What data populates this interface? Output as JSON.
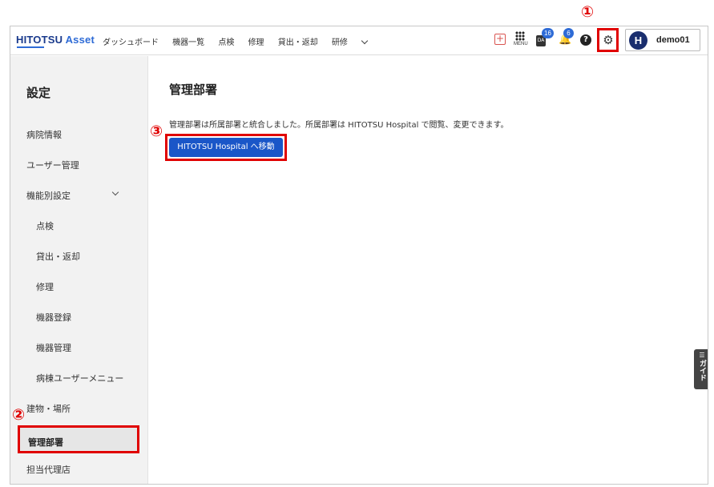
{
  "header": {
    "logo_main": "HITOTSU ",
    "logo_accent": "Asset",
    "nav": [
      "ダッシュボード",
      "機器一覧",
      "点検",
      "修理",
      "貸出・返却",
      "研修"
    ],
    "menu_label": "MENU",
    "pda_label": "DA",
    "pda_badge": "16",
    "bell_badge": "6",
    "help_glyph": "?",
    "user_initial": "H",
    "user_name": "demo01"
  },
  "sidebar": {
    "title": "設定",
    "items": [
      {
        "label": "病院情報",
        "level": "top"
      },
      {
        "label": "ユーザー管理",
        "level": "top"
      },
      {
        "label": "機能別設定",
        "level": "top",
        "expanded": true
      },
      {
        "label": "点検",
        "level": "sub"
      },
      {
        "label": "貸出・返却",
        "level": "sub"
      },
      {
        "label": "修理",
        "level": "sub"
      },
      {
        "label": "機器登録",
        "level": "sub"
      },
      {
        "label": "機器管理",
        "level": "sub"
      },
      {
        "label": "病棟ユーザーメニュー",
        "level": "sub"
      },
      {
        "label": "建物・場所",
        "level": "top"
      },
      {
        "label": "管理部署",
        "level": "top",
        "active": true
      },
      {
        "label": "担当代理店",
        "level": "top"
      }
    ]
  },
  "main": {
    "title": "管理部署",
    "description": "管理部署は所属部署と統合しました。所属部署は HITOTSU Hospital で閲覧、変更できます。",
    "button_label": "HITOTSU Hospital へ移動"
  },
  "guide_tab": {
    "label": "ガイド"
  },
  "annotations": [
    "①",
    "②",
    "③"
  ],
  "colors": {
    "brand": "#1a3a8c",
    "accent": "#2e6bd6",
    "primary_button": "#1a56c8",
    "highlight": "#e00000"
  }
}
